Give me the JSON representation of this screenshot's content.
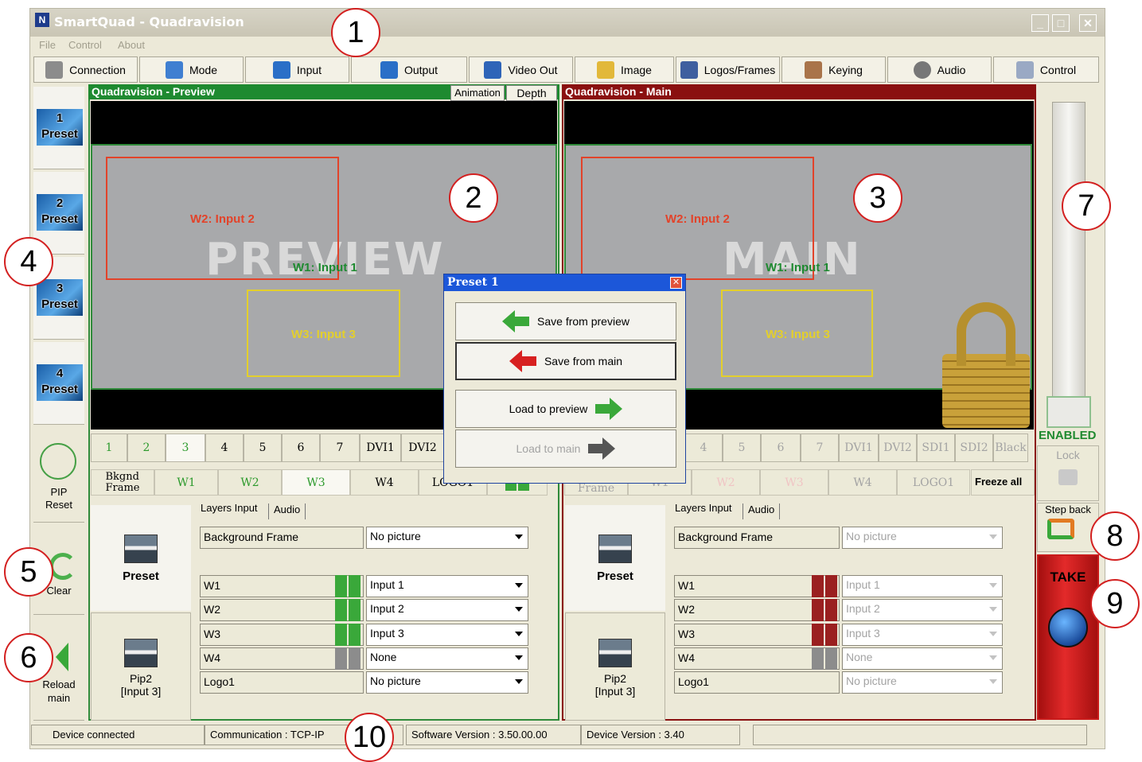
{
  "window": {
    "title": "SmartQuad - Quadravision",
    "close_glyph": "✕"
  },
  "menu": [
    "File",
    "Control",
    "About"
  ],
  "toolbar": [
    {
      "label": "Connection",
      "icon": "connection-icon"
    },
    {
      "label": "Mode",
      "icon": "mode-icon"
    },
    {
      "label": "Input",
      "icon": "input-icon"
    },
    {
      "label": "Output",
      "icon": "output-icon"
    },
    {
      "label": "Video Out",
      "icon": "video-out-icon"
    },
    {
      "label": "Image",
      "icon": "image-icon"
    },
    {
      "label": "Logos/Frames",
      "icon": "logos-frames-icon"
    },
    {
      "label": "Keying",
      "icon": "keying-icon"
    },
    {
      "label": "Audio",
      "icon": "audio-icon"
    },
    {
      "label": "Control",
      "icon": "control-icon"
    }
  ],
  "presets": [
    {
      "number": "1",
      "label": "Preset"
    },
    {
      "number": "2",
      "label": "Preset"
    },
    {
      "number": "3",
      "label": "Preset"
    },
    {
      "number": "4",
      "label": "Preset"
    }
  ],
  "sidebar": {
    "pip_reset": "PIP\nReset",
    "clear": "Clear",
    "reload_main": "Reload\nmain"
  },
  "preview": {
    "title": "Quadravision - Preview",
    "tab_animation": "Animation",
    "tab_depth": "Depth",
    "watermark": "PREVIEW",
    "w1": "W1: Input 1",
    "w2": "W2: Input 2",
    "w3": "W3: Input 3"
  },
  "main": {
    "title": "Quadravision - Main",
    "watermark": "MAIN",
    "w1": "W1: Input 1",
    "w2": "W2: Input 2",
    "w3": "W3: Input 3"
  },
  "source_tabs_left": [
    "1",
    "2",
    "3",
    "4",
    "5",
    "6",
    "7",
    "DVI1",
    "DVI2"
  ],
  "source_tabs_right": [
    "4",
    "5",
    "6",
    "7",
    "DVI1",
    "DVI2",
    "SDI1",
    "SDI2",
    "Black"
  ],
  "layers_left": [
    "Bkgnd\nFrame",
    "W1",
    "W2",
    "W3",
    "W4",
    "LOGO1"
  ],
  "layers_right": [
    "Frame",
    "W1",
    "W2",
    "W3",
    "W4",
    "LOGO1"
  ],
  "freeze_all": "Freeze all",
  "subtabs": {
    "layers": "Layers Input",
    "audio": "Audio"
  },
  "tiles": {
    "preset": "Preset",
    "pip2": "Pip2\n[Input 3]"
  },
  "rows": [
    {
      "name": "Background Frame",
      "value": "No picture"
    },
    {
      "name": "W1",
      "value": "Input 1"
    },
    {
      "name": "W2",
      "value": "Input 2"
    },
    {
      "name": "W3",
      "value": "Input 3"
    },
    {
      "name": "W4",
      "value": "None"
    },
    {
      "name": "Logo1",
      "value": "No picture"
    }
  ],
  "right_panel": {
    "enabled": "ENABLED",
    "lock": "Lock",
    "step_back": "Step back",
    "take": "TAKE"
  },
  "dialog": {
    "title": "Preset 1",
    "save_preview": "Save from preview",
    "save_main": "Save from main",
    "load_preview": "Load to preview",
    "load_main": "Load to main"
  },
  "status": {
    "device": "Device connected",
    "comm": "Communication : TCP-IP",
    "software": "Software Version : 3.50.00.00",
    "device_version": "Device Version : 3.40"
  },
  "callouts": [
    "1",
    "2",
    "3",
    "4",
    "5",
    "6",
    "7",
    "8",
    "9",
    "10"
  ]
}
